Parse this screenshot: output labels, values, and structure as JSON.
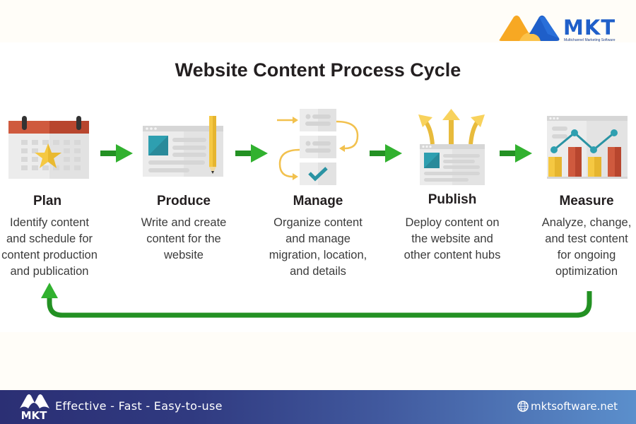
{
  "brand": {
    "name": "MKT",
    "subtitle": "Multichannel Marketing Software",
    "colors": {
      "orange": "#f7a823",
      "blue": "#1f5fc9"
    }
  },
  "title": "Website Content Process Cycle",
  "steps": [
    {
      "name": "Plan",
      "icon": "calendar-star-icon",
      "description": "Identify content\nand schedule for\ncontent production\nand publication"
    },
    {
      "name": "Produce",
      "icon": "webpage-pencil-icon",
      "description": "Write and create\ncontent for the\nwebsite"
    },
    {
      "name": "Manage",
      "icon": "workflow-checklist-icon",
      "description": "Organize content\nand manage\nmigration, location,\nand details"
    },
    {
      "name": "Publish",
      "icon": "webpage-broadcast-icon",
      "description": "Deploy content on\nthe website and\nother content hubs"
    },
    {
      "name": "Measure",
      "icon": "analytics-chart-icon",
      "description": "Analyze, change,\nand test content\nfor ongoing\noptimization"
    }
  ],
  "connector_color": "#2e9b2a",
  "footer": {
    "logo_text": "MKT",
    "tagline": "Effective - Fast - Easy-to-use",
    "website": "mktsoftware.net"
  }
}
